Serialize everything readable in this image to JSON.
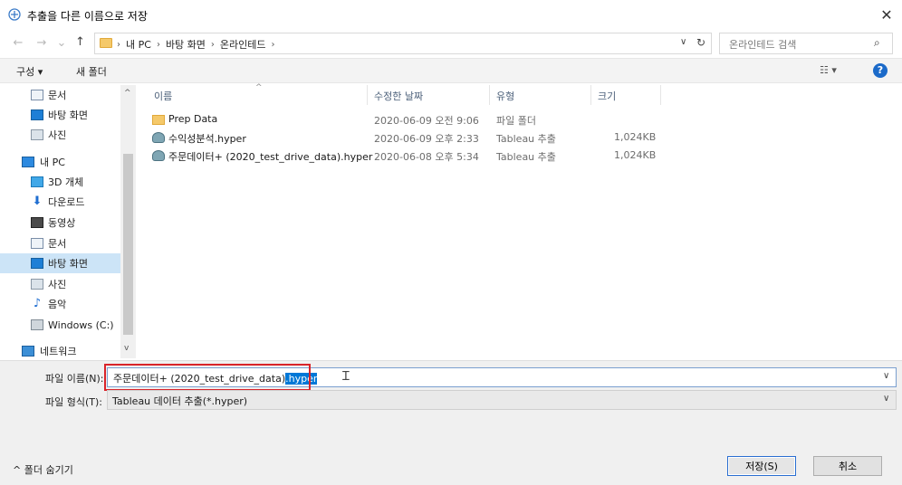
{
  "window": {
    "title": "추출을 다른 이름으로 저장",
    "close": "✕"
  },
  "nav": {
    "back": "←",
    "forward": "→",
    "recent": "⌄",
    "up": "↑"
  },
  "address": {
    "crumbs": [
      "내 PC",
      "바탕 화면",
      "온라인테드"
    ],
    "dropdown": "∨",
    "refresh": "↻"
  },
  "search": {
    "placeholder": "온라인테드 검색",
    "icon": "⌕"
  },
  "toolbar": {
    "organize_label": "구성 ▾",
    "new_folder_label": "새 폴더",
    "view_label": "☷ ▾",
    "help_label": "?"
  },
  "sidebar": {
    "scroll_up": "^",
    "scroll_down": "v",
    "items": [
      {
        "label": "문서",
        "icon": "document-icon"
      },
      {
        "label": "바탕 화면",
        "icon": "desktop-icon"
      },
      {
        "label": "사진",
        "icon": "pictures-icon"
      },
      {
        "label": "내 PC",
        "icon": "this-pc-icon"
      },
      {
        "label": "3D 개체",
        "icon": "3d-objects-icon"
      },
      {
        "label": "다운로드",
        "icon": "downloads-icon"
      },
      {
        "label": "동영상",
        "icon": "videos-icon"
      },
      {
        "label": "문서",
        "icon": "document-icon"
      },
      {
        "label": "바탕 화면",
        "icon": "desktop-icon"
      },
      {
        "label": "사진",
        "icon": "pictures-icon"
      },
      {
        "label": "음악",
        "icon": "music-icon"
      },
      {
        "label": "Windows (C:)",
        "icon": "drive-icon"
      },
      {
        "label": "네트워크",
        "icon": "network-icon"
      }
    ]
  },
  "filelist": {
    "columns": {
      "name": "이름",
      "modified": "수정한 날짜",
      "type": "유형",
      "size": "크기"
    },
    "sort_indicator": "^",
    "rows": [
      {
        "name": "Prep Data",
        "modified": "2020-06-09 오전 9:06",
        "type": "파일 폴더",
        "size": "",
        "icon": "folder-icon"
      },
      {
        "name": "수익성분석.hyper",
        "modified": "2020-06-09 오후 2:33",
        "type": "Tableau 추출",
        "size": "1,024KB",
        "icon": "hyper-file-icon"
      },
      {
        "name": "주문데이터+ (2020_test_drive_data).hyper",
        "modified": "2020-06-08 오후 5:34",
        "type": "Tableau 추출",
        "size": "1,024KB",
        "icon": "hyper-file-icon"
      }
    ]
  },
  "save_form": {
    "filename_label": "파일 이름(N):",
    "filename_base": "주문데이터+ (2020_test_drive_data)",
    "filename_selected": ".hyper",
    "filetype_label": "파일 형식(T):",
    "filetype_value": "Tableau 데이터 추출(*.hyper)",
    "dropdown": "∨"
  },
  "footer": {
    "hide_folders_label": "^ 폴더 숨기기",
    "save_label": "저장(S)",
    "cancel_label": "취소"
  }
}
